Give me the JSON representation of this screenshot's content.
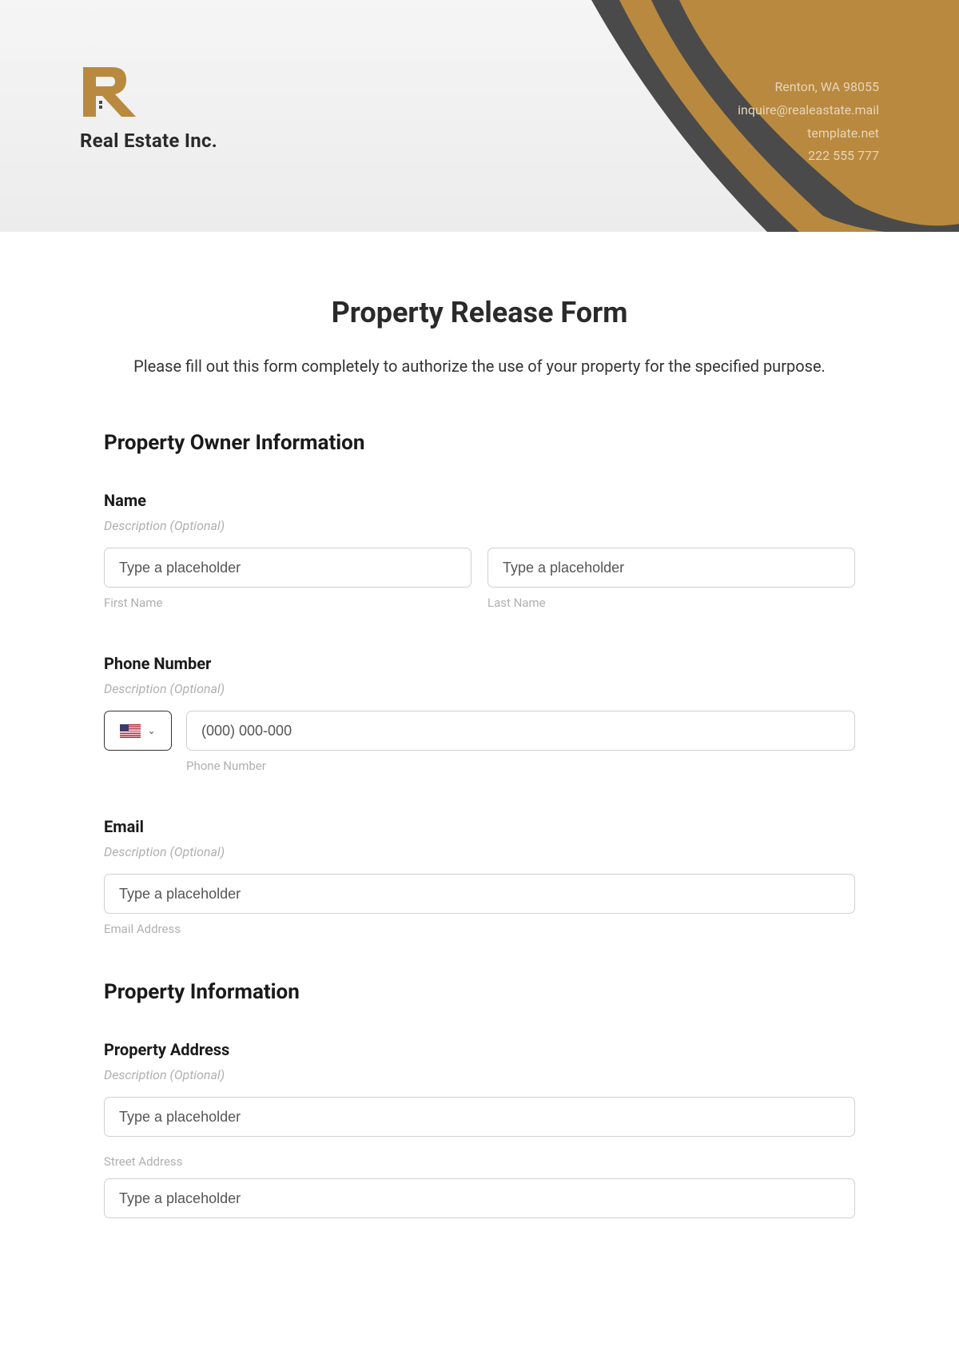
{
  "header": {
    "company_name": "Real Estate Inc.",
    "contact": {
      "address": "Renton, WA 98055",
      "email": "inquire@realeastate.mail",
      "website": "template.net",
      "phone": "222 555 777"
    }
  },
  "form": {
    "title": "Property Release Form",
    "intro": "Please fill out this form completely to authorize the use of your property for the specified purpose.",
    "section1_heading": "Property Owner Information",
    "name": {
      "label": "Name",
      "desc": "Description (Optional)",
      "first_placeholder": "Type a placeholder",
      "last_placeholder": "Type a placeholder",
      "first_sublabel": "First Name",
      "last_sublabel": "Last Name"
    },
    "phone": {
      "label": "Phone Number",
      "desc": "Description (Optional)",
      "placeholder": "(000) 000-000",
      "sublabel": "Phone Number"
    },
    "email": {
      "label": "Email",
      "desc": "Description (Optional)",
      "placeholder": "Type a placeholder",
      "sublabel": "Email Address"
    },
    "section2_heading": "Property Information",
    "address": {
      "label": "Property Address",
      "desc": "Description (Optional)",
      "street_placeholder": "Type a placeholder",
      "street_sublabel": "Street Address",
      "line2_placeholder": "Type a placeholder"
    }
  },
  "colors": {
    "brand_gold": "#b8893f",
    "brand_dark": "#4a4a4a"
  }
}
